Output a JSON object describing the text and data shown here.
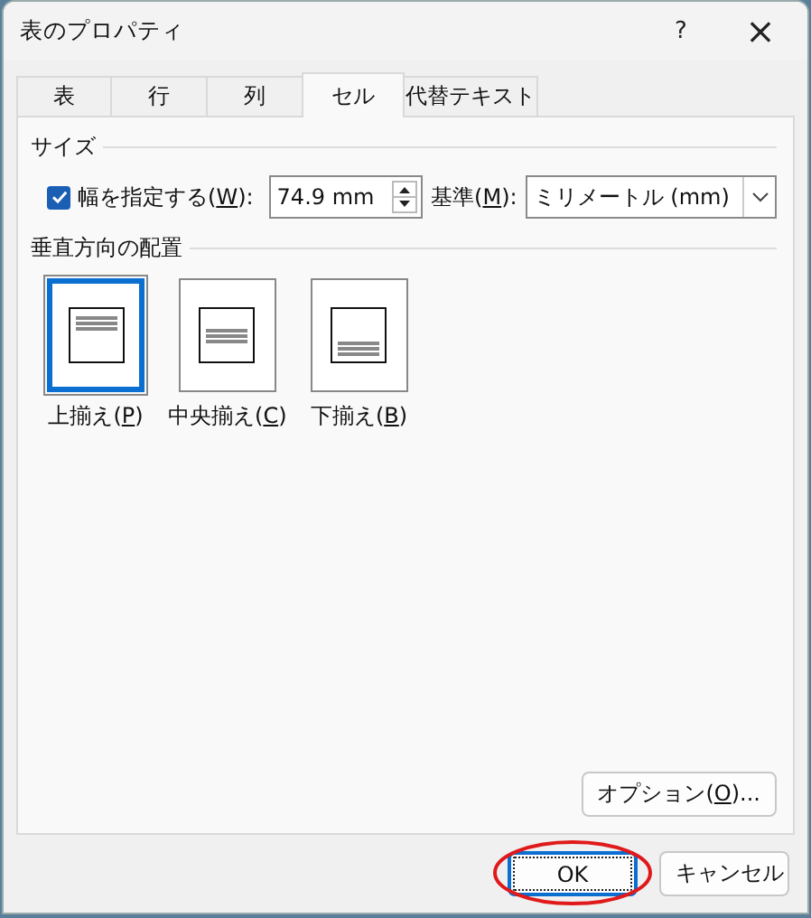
{
  "window": {
    "title": "表のプロパティ",
    "help": "?",
    "close": "×"
  },
  "tabs": [
    {
      "label": "表",
      "selected": false
    },
    {
      "label": "行",
      "selected": false
    },
    {
      "label": "列",
      "selected": false
    },
    {
      "label": "セル",
      "selected": true
    },
    {
      "label": "代替テキスト",
      "selected": false
    }
  ],
  "size": {
    "heading": "サイズ",
    "width_checkbox": {
      "label_before": "幅を指定する(",
      "access_key": "W",
      "label_after": "):",
      "checked": true
    },
    "width_value": "74.9 mm",
    "unit_label": {
      "label_before": "基準(",
      "access_key": "M",
      "label_after": "):"
    },
    "unit_value": "ミリメートル (mm)"
  },
  "vertical_alignment": {
    "heading": "垂直方向の配置",
    "options": [
      {
        "kind": "top",
        "label_before": "上揃え(",
        "access_key": "P",
        "label_after": ")",
        "selected": true
      },
      {
        "kind": "center",
        "label_before": "中央揃え(",
        "access_key": "C",
        "label_after": ")",
        "selected": false
      },
      {
        "kind": "bottom",
        "label_before": "下揃え(",
        "access_key": "B",
        "label_after": ")",
        "selected": false
      }
    ]
  },
  "options_button": {
    "label_before": "オプション(",
    "access_key": "O",
    "label_after": ")..."
  },
  "buttons": [
    {
      "label": "OK",
      "kind": "default",
      "highlighted": true
    },
    {
      "label": "キャンセル",
      "kind": "normal",
      "highlighted": false
    }
  ]
}
